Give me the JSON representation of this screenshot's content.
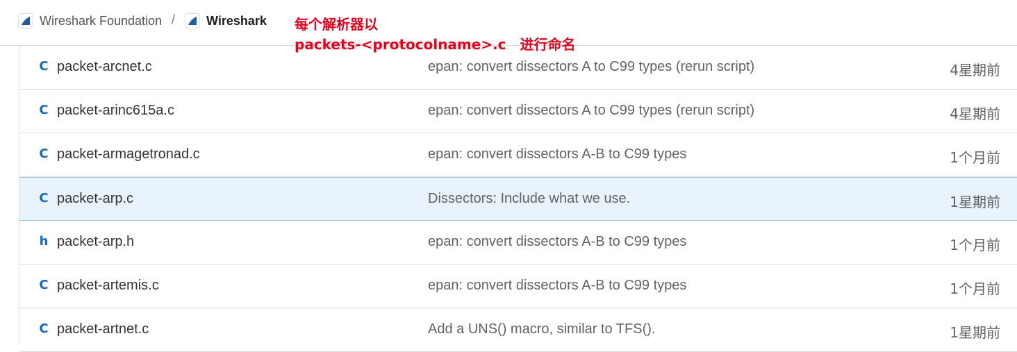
{
  "breadcrumb": {
    "group": "Wireshark Foundation",
    "separator": "/",
    "project": "Wireshark",
    "logo_icon": "shark-fin-icon",
    "logo_color": "#1f5aa6"
  },
  "annotation": {
    "line1": "每个解析器以",
    "line2_code": "packets-<protocolname>.c",
    "line2_text": "进行命名",
    "color": "#e8001c"
  },
  "files": [
    {
      "icon": "c-file-icon",
      "glyph": "C",
      "name": "packet-arcnet.c",
      "commit": "epan: convert dissectors A to C99 types (rerun script)",
      "time": "4星期前"
    },
    {
      "icon": "c-file-icon",
      "glyph": "C",
      "name": "packet-arinc615a.c",
      "commit": "epan: convert dissectors A to C99 types (rerun script)",
      "time": "4星期前"
    },
    {
      "icon": "c-file-icon",
      "glyph": "C",
      "name": "packet-armagetronad.c",
      "commit": "epan: convert dissectors A-B to C99 types",
      "time": "1个月前"
    },
    {
      "icon": "c-file-icon",
      "glyph": "C",
      "name": "packet-arp.c",
      "commit": "Dissectors: Include what we use.",
      "time": "1星期前",
      "selected": true
    },
    {
      "icon": "h-file-icon",
      "glyph": "h",
      "name": "packet-arp.h",
      "commit": "epan: convert dissectors A-B to C99 types",
      "time": "1个月前"
    },
    {
      "icon": "c-file-icon",
      "glyph": "C",
      "name": "packet-artemis.c",
      "commit": "epan: convert dissectors A-B to C99 types",
      "time": "1个月前"
    },
    {
      "icon": "c-file-icon",
      "glyph": "C",
      "name": "packet-artnet.c",
      "commit": "Add a UNS() macro, similar to TFS().",
      "time": "1星期前"
    }
  ]
}
